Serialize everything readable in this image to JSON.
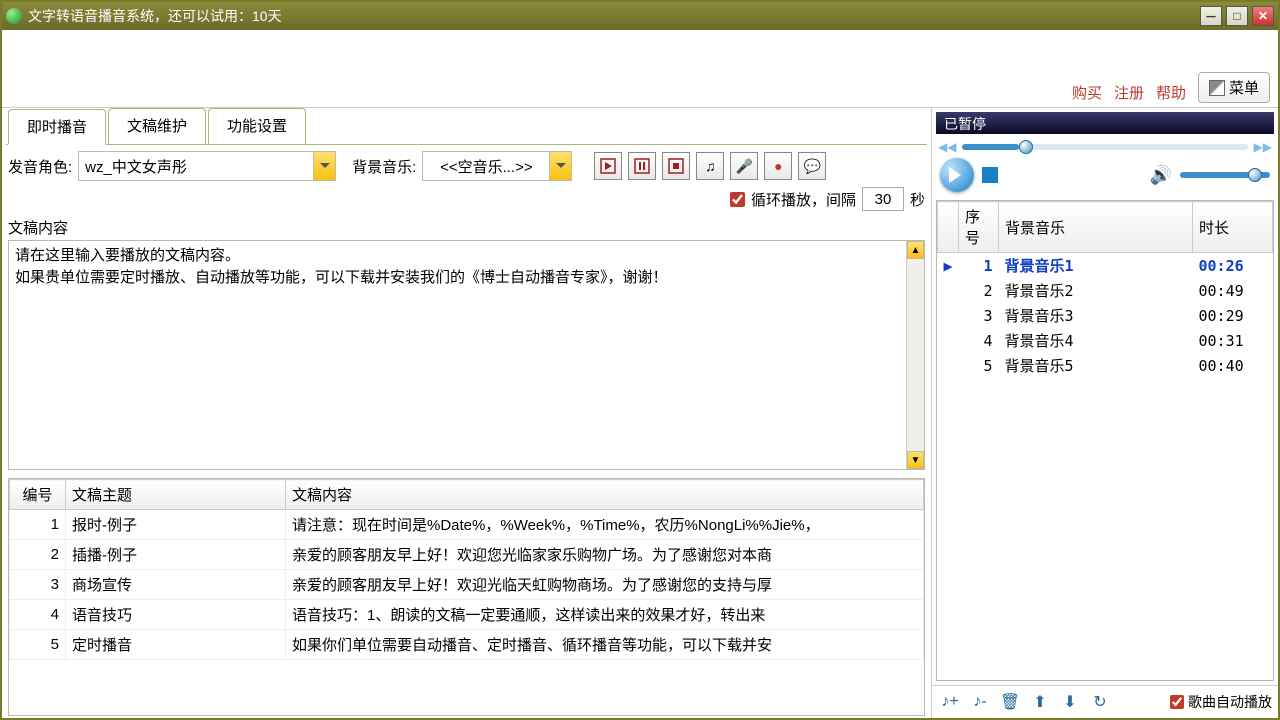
{
  "window": {
    "title": "文字转语音播音系统，还可以试用：10天"
  },
  "topbar": {
    "buy": "购买",
    "register": "注册",
    "help": "帮助",
    "menu": "菜单"
  },
  "tabs": [
    "即时播音",
    "文稿维护",
    "功能设置"
  ],
  "voice": {
    "label": "发音角色:",
    "value": "wz_中文女声彤"
  },
  "bgm": {
    "label": "背景音乐:",
    "value": "<<空音乐...>>"
  },
  "loop": {
    "checked": true,
    "label1": "循环播放，间隔",
    "value": "30",
    "label2": "秒"
  },
  "doc": {
    "label": "文稿内容",
    "text": "请在这里输入要播放的文稿内容。\n如果贵单位需要定时播放、自动播放等功能，可以下载并安装我们的《博士自动播音专家》，谢谢！"
  },
  "docs_table": {
    "headers": [
      "编号",
      "文稿主题",
      "文稿内容"
    ],
    "rows": [
      {
        "n": "1",
        "topic": "报时-例子",
        "content": "请注意：现在时间是%Date%，%Week%，%Time%，农历%NongLi%%Jie%，"
      },
      {
        "n": "2",
        "topic": "插播-例子",
        "content": "亲爱的顾客朋友早上好！欢迎您光临家家乐购物广场。为了感谢您对本商"
      },
      {
        "n": "3",
        "topic": "商场宣传",
        "content": "亲爱的顾客朋友早上好！欢迎光临天虹购物商场。为了感谢您的支持与厚"
      },
      {
        "n": "4",
        "topic": "语音技巧",
        "content": "语音技巧：1、朗读的文稿一定要通顺，这样读出来的效果才好，转出来"
      },
      {
        "n": "5",
        "topic": "定时播音",
        "content": "如果你们单位需要自动播音、定时播音、循环播音等功能，可以下载并安"
      }
    ]
  },
  "player": {
    "status": "已暂停"
  },
  "playlist": {
    "headers": [
      "序号",
      "背景音乐",
      "时长"
    ],
    "rows": [
      {
        "n": "1",
        "name": "背景音乐1",
        "dur": "00:26",
        "cur": true
      },
      {
        "n": "2",
        "name": "背景音乐2",
        "dur": "00:49"
      },
      {
        "n": "3",
        "name": "背景音乐3",
        "dur": "00:29"
      },
      {
        "n": "4",
        "name": "背景音乐4",
        "dur": "00:31"
      },
      {
        "n": "5",
        "name": "背景音乐5",
        "dur": "00:40"
      }
    ]
  },
  "pl_toolbar": {
    "auto_label": "歌曲自动播放"
  }
}
